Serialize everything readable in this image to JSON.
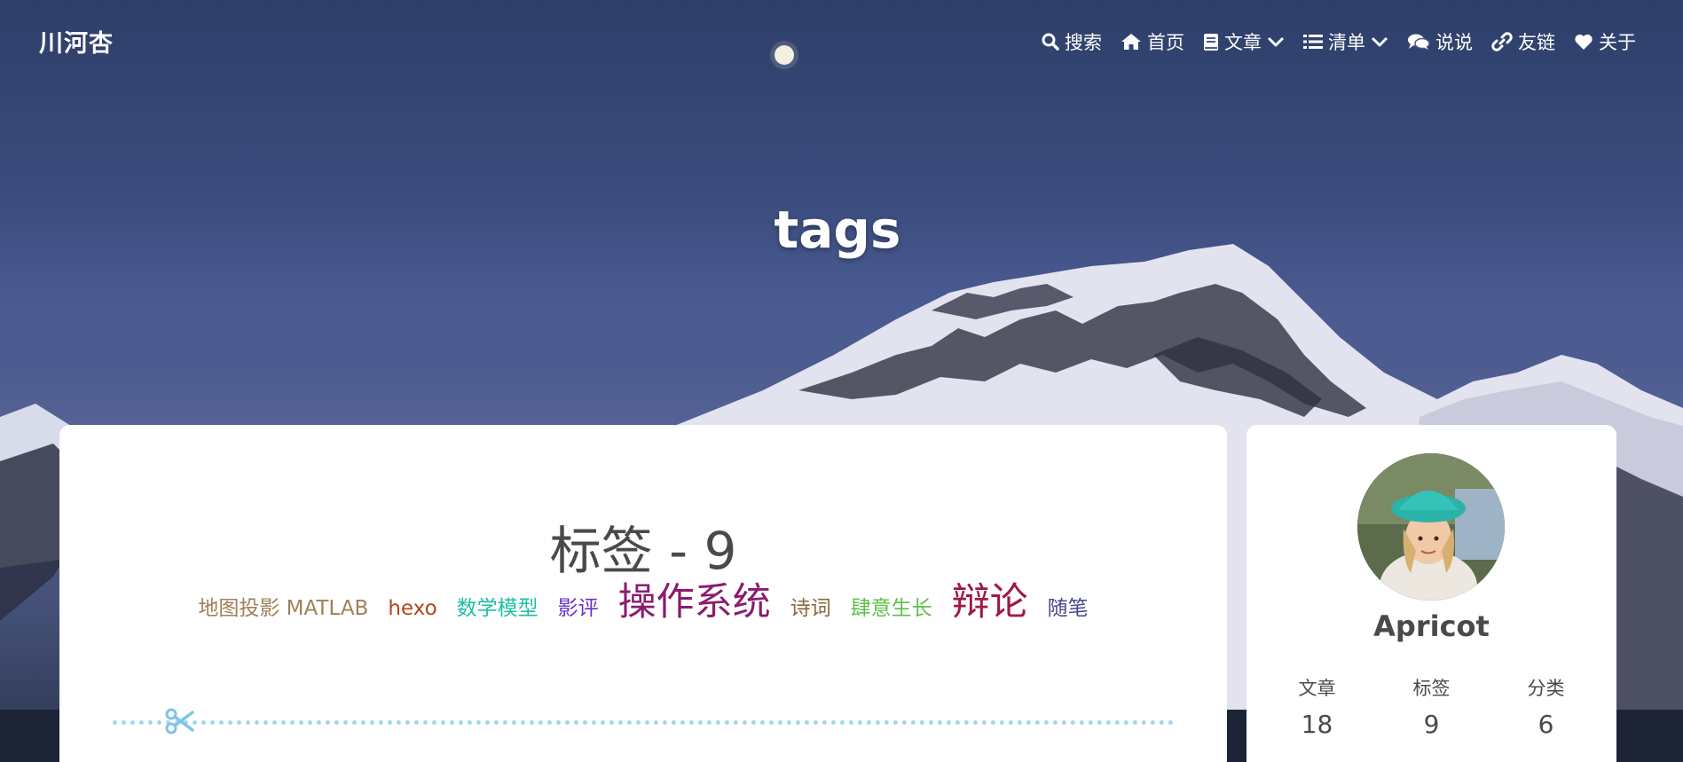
{
  "site": {
    "brand": "川河杏",
    "page_title": "tags"
  },
  "nav": {
    "items": [
      {
        "label": "搜索",
        "icon": "search-icon"
      },
      {
        "label": "首页",
        "icon": "home-icon"
      },
      {
        "label": "文章",
        "icon": "book-icon",
        "dropdown": true
      },
      {
        "label": "清单",
        "icon": "list-icon",
        "dropdown": true
      },
      {
        "label": "说说",
        "icon": "comments-icon"
      },
      {
        "label": "友链",
        "icon": "link-icon"
      },
      {
        "label": "关于",
        "icon": "heart-icon"
      }
    ]
  },
  "tags_panel": {
    "heading": "标签 - 9",
    "tags": [
      {
        "label": "地图投影 MATLAB",
        "color": "#a08058"
      },
      {
        "label": "hexo",
        "color": "#b0471d"
      },
      {
        "label": "数学模型",
        "color": "#1ebfa4"
      },
      {
        "label": "影评",
        "color": "#6a2fc9"
      },
      {
        "label": "操作系统",
        "color": "#8a1c6f"
      },
      {
        "label": "诗词",
        "color": "#8a6a3a"
      },
      {
        "label": "肆意生长",
        "color": "#5fbf4a"
      },
      {
        "label": "辩论",
        "color": "#a0184a"
      },
      {
        "label": "随笔",
        "color": "#4a4a8a"
      }
    ]
  },
  "author": {
    "name": "Apricot",
    "stats": [
      {
        "label": "文章",
        "value": "18"
      },
      {
        "label": "标签",
        "value": "9"
      },
      {
        "label": "分类",
        "value": "6"
      }
    ]
  },
  "colors": {
    "divider": "#a3d6ef",
    "text": "#4c4948"
  }
}
